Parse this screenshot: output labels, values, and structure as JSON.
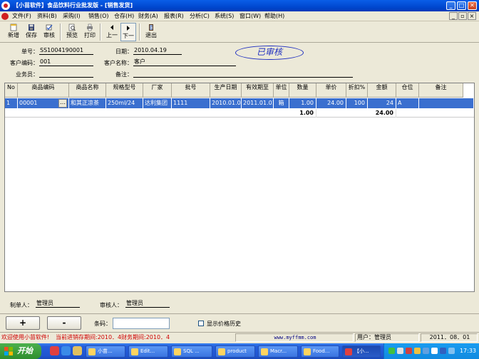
{
  "window": {
    "title": "【小苗软件】食品饮料行业批发版 - [销售发货]"
  },
  "menu": [
    "文件(F)",
    "资料(B)",
    "采购(I)",
    "销售(O)",
    "仓存(H)",
    "财务(A)",
    "报表(R)",
    "分析(C)",
    "系统(S)",
    "窗口(W)",
    "帮助(H)"
  ],
  "toolbar": {
    "new": "新增",
    "save": "保存",
    "audit": "审核",
    "preview": "预览",
    "print": "打印",
    "prev": "上一",
    "next": "下一",
    "exit": "退出"
  },
  "form": {
    "order_no_label": "单号：",
    "order_no": "SS1004190001",
    "date_label": "日期：",
    "date": "2010.04.19",
    "customer_code_label": "客户编码：",
    "customer_code": "001",
    "customer_name_label": "客户名称：",
    "customer_name": "客户",
    "salesman_label": "业务员：",
    "salesman": "",
    "remark_label": "备注：",
    "remark": "",
    "stamp": "已审核"
  },
  "grid": {
    "columns": [
      "No",
      "商品编码",
      "商品名称",
      "规格型号",
      "厂家",
      "批号",
      "生产日期",
      "有效期至",
      "单位",
      "数量",
      "单价",
      "折扣%",
      "金额",
      "仓位",
      "备注"
    ],
    "rows": [
      {
        "no": "1",
        "code": "00001",
        "name": "和其正凉茶",
        "spec": "250ml/24",
        "maker": "达利集团",
        "batch": "1111",
        "mfg": "2010.01.01",
        "exp": "2011.01.01",
        "unit": "箱",
        "qty": "1.00",
        "price": "24.00",
        "discount": "100",
        "amount": "24",
        "location": "A",
        "note": ""
      }
    ],
    "totals": {
      "qty": "1.00",
      "amount": "24.00"
    }
  },
  "footer": {
    "maker_label": "制单人：",
    "maker": "管理员",
    "auditor_label": "审核人：",
    "auditor": "管理员",
    "add_btn": "+",
    "del_btn": "-",
    "barcode_label": "条码：",
    "barcode": "",
    "price_history_label": "显示价格历史"
  },
  "status": {
    "welcome": "欢迎使用小苗软件!",
    "inventory_period": "当前进销存期间:2010．4",
    "finance_period": "财务期间:2010．4",
    "website": "www.myffmm.com",
    "user": "用户：管理员",
    "date": "2011．08．01"
  },
  "taskbar": {
    "start": "开始",
    "tasks": [
      "小苗...",
      "Edit...",
      "SQL ...",
      "product",
      "Macr...",
      "Food...",
      "【小..."
    ],
    "clock": "17:33"
  },
  "colors": {
    "title_bar": "#0a5ee8",
    "selection": "#3a6fcf",
    "stamp": "#2030c0",
    "status_red": "#d00000"
  }
}
